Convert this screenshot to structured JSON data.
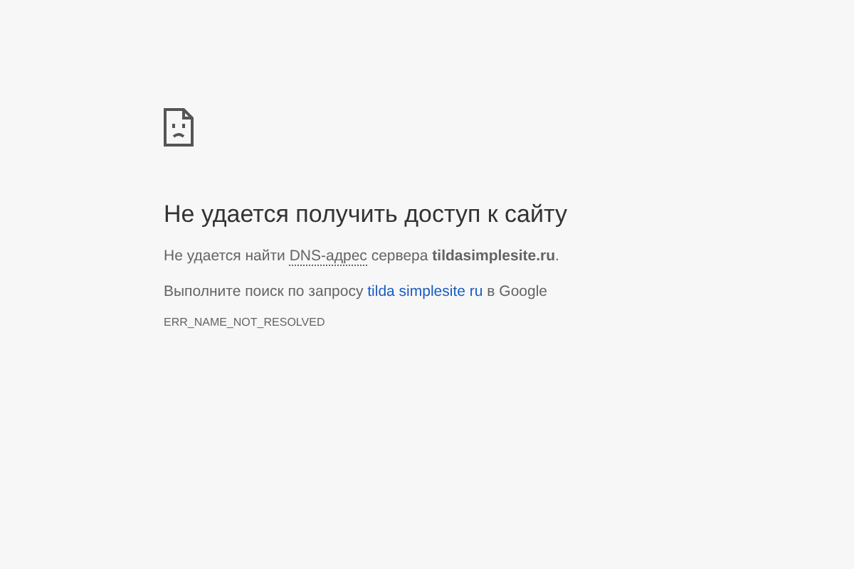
{
  "heading": "Не удается получить доступ к сайту",
  "message": [
    {
      "kind": "text",
      "text": "Не удается найти "
    },
    {
      "kind": "abbr",
      "text": "DNS-адрес"
    },
    {
      "kind": "text",
      "text": " сервера **tildasimplesite.ru**."
    }
  ],
  "suggestion": {
    "before": "Выполните поиск по запросу ",
    "link": "tilda simplesite ru",
    "after": " в Google"
  },
  "error_code": "ERR_NAME_NOT_RESOLVED"
}
